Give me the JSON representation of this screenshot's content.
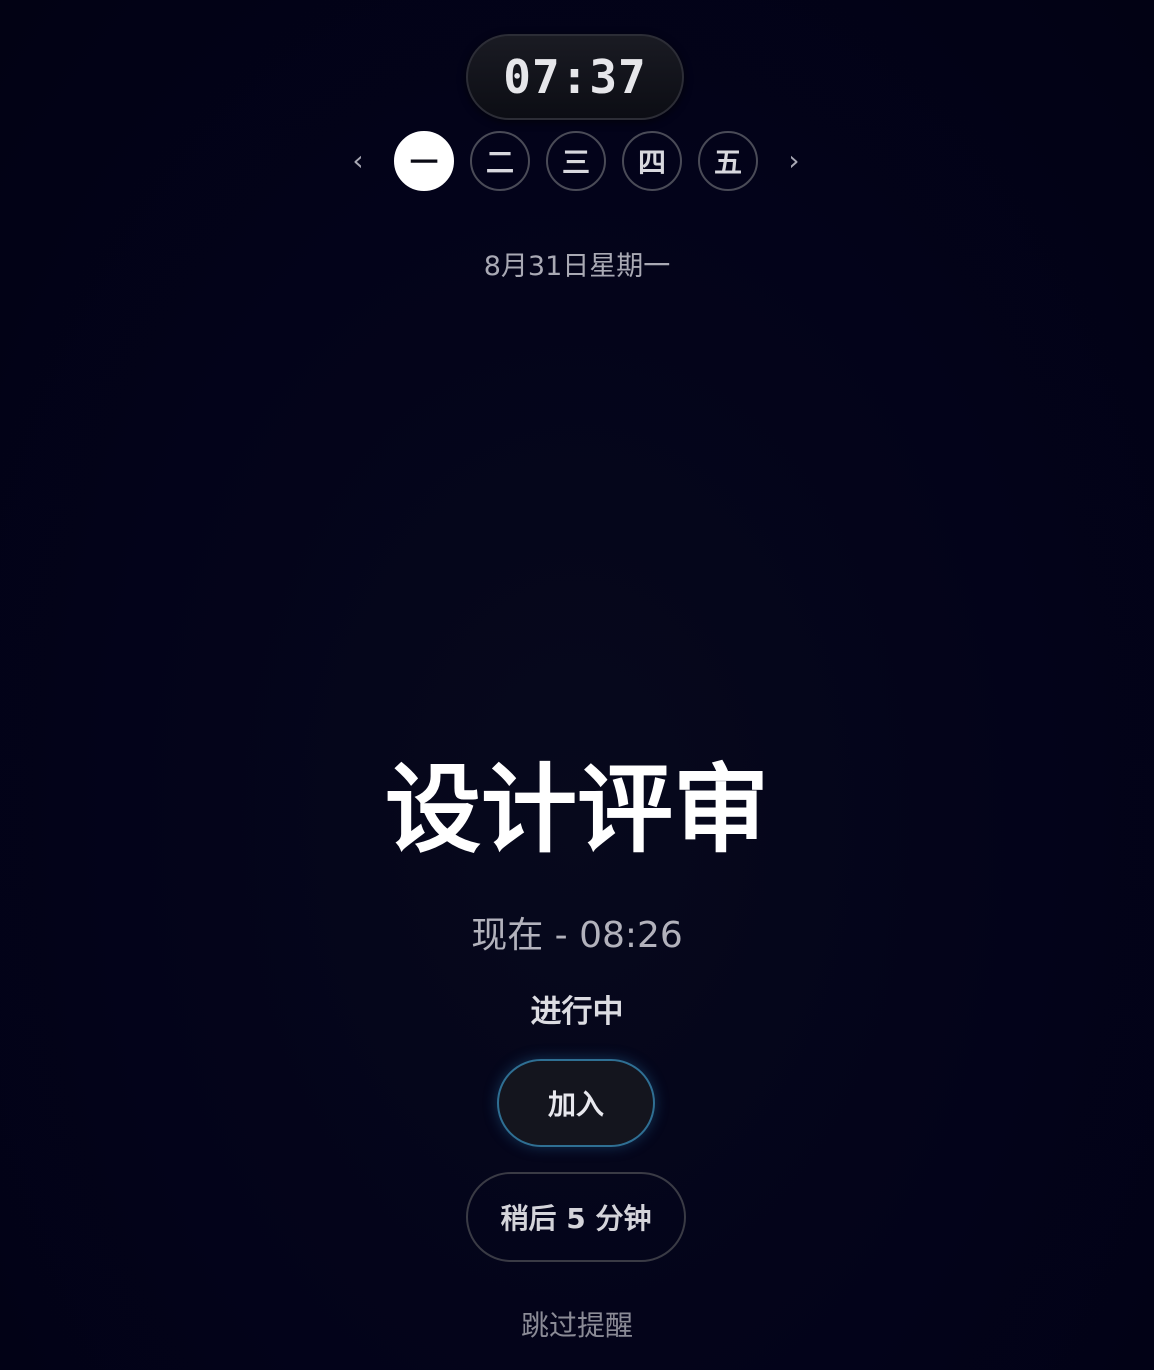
{
  "clock": {
    "time": "07:37"
  },
  "day_nav": {
    "prev_label": "‹",
    "next_label": "›",
    "days": [
      {
        "label": "一",
        "active": true
      },
      {
        "label": "二",
        "active": false
      },
      {
        "label": "三",
        "active": false
      },
      {
        "label": "四",
        "active": false
      },
      {
        "label": "五",
        "active": false
      }
    ]
  },
  "date_label": "8月31日星期一",
  "event": {
    "title": "设计评审",
    "time_range": "现在 - 08:26",
    "status": "进行中"
  },
  "actions": {
    "join_label": "加入",
    "snooze_label": "稍后 5 分钟",
    "skip_label": "跳过提醒"
  },
  "colors": {
    "background": "#03031a",
    "join_border": "#2f6f93",
    "active_day": "#ffffff"
  }
}
